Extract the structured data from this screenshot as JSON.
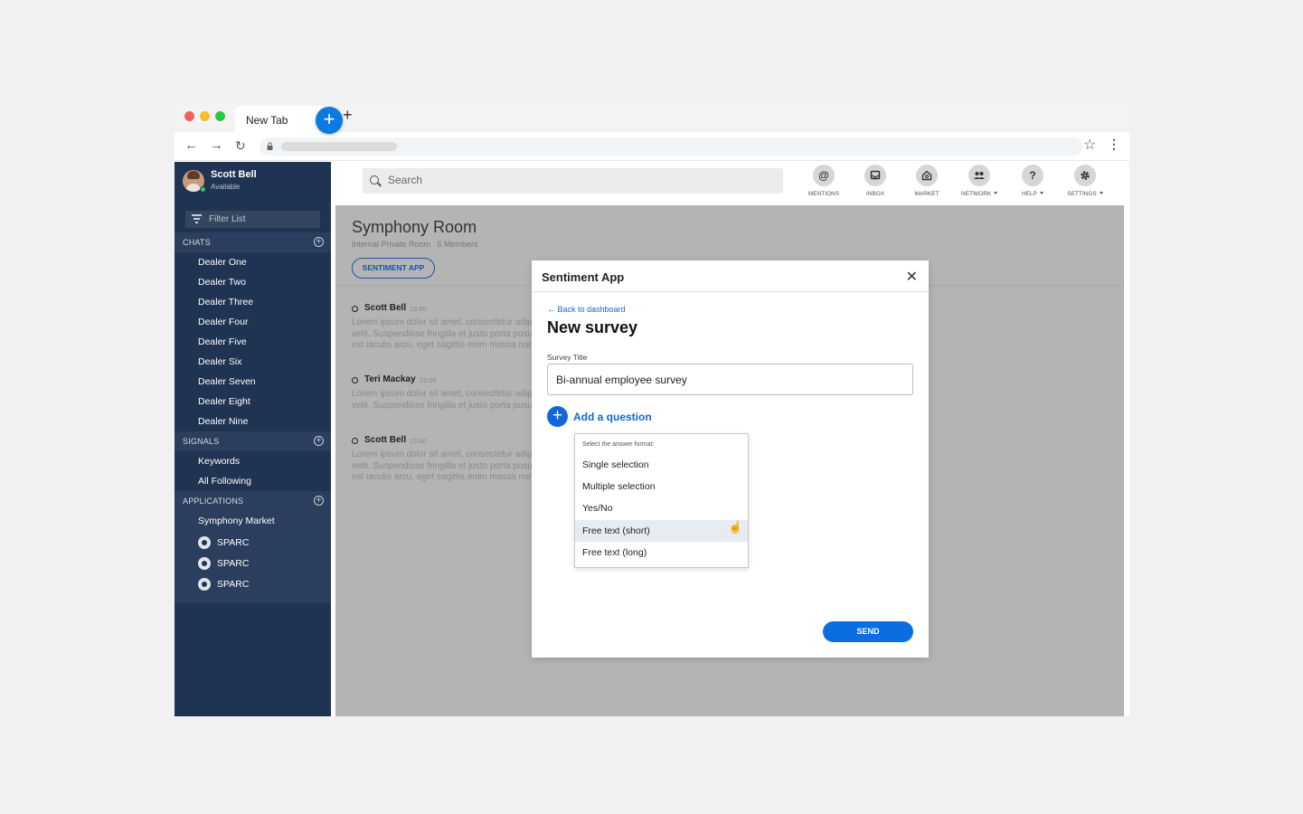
{
  "browser": {
    "tab_title": "New Tab",
    "tab_close": "×",
    "new_tab": "+"
  },
  "user": {
    "name": "Scott Bell",
    "status": "Available"
  },
  "sidebar": {
    "filter_placeholder": "Filter List",
    "sections": {
      "chats": "CHATS",
      "signals": "SIGNALS",
      "applications": "APPLICATIONS"
    },
    "chats": [
      "Dealer One",
      "Dealer Two",
      "Dealer Three",
      "Dealer Four",
      "Dealer Five",
      "Dealer Six",
      "Dealer Seven",
      "Dealer Eight",
      "Dealer Nine"
    ],
    "signals": [
      "Keywords",
      "All Following"
    ],
    "applications": [
      "Symphony Market",
      "SPARC",
      "SPARC",
      "SPARC"
    ]
  },
  "search": {
    "placeholder": "Search"
  },
  "nav": {
    "mentions": "MENTIONS",
    "inbox": "INBOX",
    "market": "MARKET",
    "network": "NETWORK",
    "help": "HELP",
    "settings": "SETTINGS"
  },
  "room": {
    "title": "Symphony Room",
    "meta": "Internal Private Room   5 Members",
    "app_button": "SENTIMENT APP",
    "messages": [
      {
        "author": "Scott Bell",
        "time": "13:00",
        "lines": [
          "Lorem ipsum dolor sit amet, consectetur adipiscing elit.",
          "velit. Suspendisse fringilla et justo porta posuere.",
          "est iaculis arcu, eget sagittis enim massa non"
        ]
      },
      {
        "author": "Teri Mackay",
        "time": "13:00",
        "lines": [
          "Lorem ipsum dolor sit amet, consectetur adipiscing elit.",
          "velit. Suspendisse fringilla et justo porta posuere."
        ]
      },
      {
        "author": "Scott Bell",
        "time": "13:00",
        "lines": [
          "Lorem ipsum dolor sit amet, consectetur adipiscing elit.",
          "velit. Suspendisse fringilla et justo porta posuere.",
          "est iaculis arcu, eget sagittis enim massa non"
        ]
      }
    ]
  },
  "modal": {
    "title": "Sentiment App",
    "back": "← Back to dashboard",
    "heading": "New survey",
    "field_label": "Survey Title",
    "field_value": "Bi-annual employee survey",
    "add_question": "Add a question",
    "dropdown": {
      "header": "Select the answer format:",
      "options": [
        "Single selection",
        "Multiple selection",
        "Yes/No",
        "Free text (short)",
        "Free text (long)"
      ],
      "highlighted": "Free text (short)"
    },
    "send": "SEND"
  },
  "colors": {
    "sidebar": "#1f3352",
    "accent": "#1366d6",
    "overlay": "#b4b4b4"
  }
}
